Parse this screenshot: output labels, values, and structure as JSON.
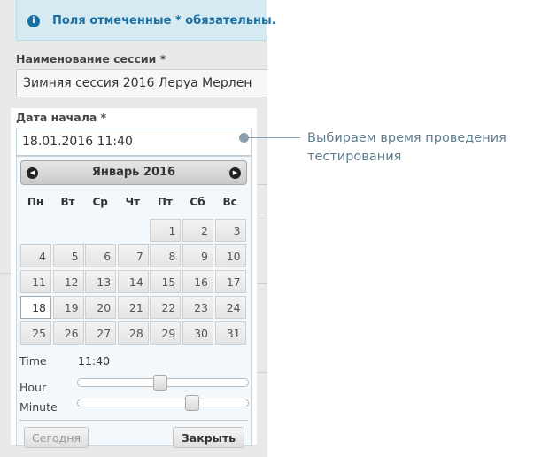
{
  "notice": {
    "text": "Поля отмеченные * обязательны."
  },
  "session": {
    "label": "Наименование сессии *",
    "value": "Зимняя сессия 2016 Леруа Мерлен"
  },
  "start_date": {
    "label": "Дата начала *",
    "value": "18.01.2016 11:40"
  },
  "annotation": {
    "text": "Выбираем время проведения тестирования"
  },
  "datepicker": {
    "month_title": "Январь 2016",
    "weekdays": [
      "Пн",
      "Вт",
      "Ср",
      "Чт",
      "Пт",
      "Сб",
      "Вс"
    ],
    "days": [
      "1",
      "2",
      "3",
      "4",
      "5",
      "6",
      "7",
      "8",
      "9",
      "10",
      "11",
      "12",
      "13",
      "14",
      "15",
      "16",
      "17",
      "18",
      "19",
      "20",
      "21",
      "22",
      "23",
      "24",
      "25",
      "26",
      "27",
      "28",
      "29",
      "30",
      "31"
    ],
    "first_weekday_index": 4,
    "selected_day": 18,
    "time_label": "Time",
    "time_value": "11:40",
    "hour_label": "Hour",
    "minute_label": "Minute",
    "hour": 11,
    "minute": 40,
    "today_button": "Сегодня",
    "close_button": "Закрыть"
  },
  "colors": {
    "accent": "#1d6fa0",
    "annotation": "#5d7d8c",
    "picker_bg": "#f2f8fb"
  }
}
